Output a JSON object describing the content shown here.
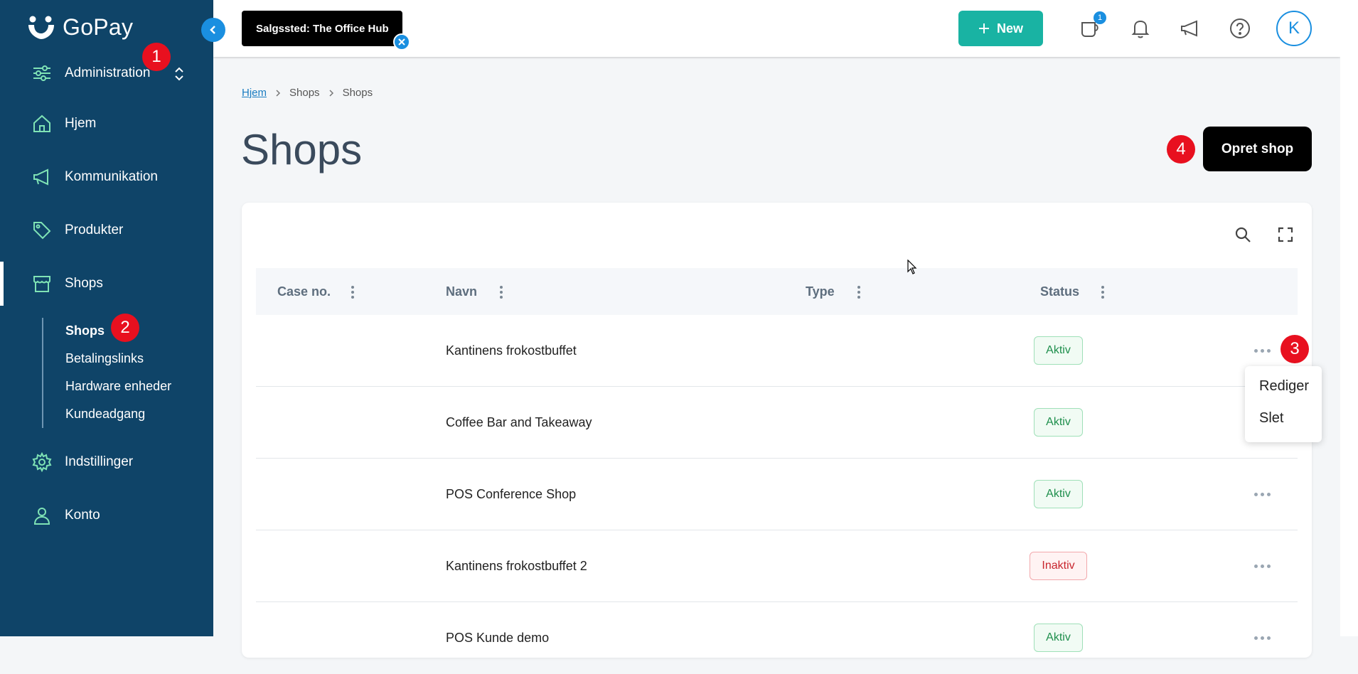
{
  "app": {
    "logo_text": "GoPay"
  },
  "sidebar": {
    "workspace": "Administration",
    "items": [
      {
        "label": "Hjem",
        "icon": "home-icon"
      },
      {
        "label": "Kommunikation",
        "icon": "megaphone-icon"
      },
      {
        "label": "Produkter",
        "icon": "tag-icon"
      },
      {
        "label": "Shops",
        "icon": "store-icon"
      },
      {
        "label": "Indstillinger",
        "icon": "gear-icon"
      },
      {
        "label": "Konto",
        "icon": "user-icon"
      }
    ],
    "sub_items": [
      {
        "label": "Shops"
      },
      {
        "label": "Betalingslinks"
      },
      {
        "label": "Hardware enheder"
      },
      {
        "label": "Kundeadgang"
      }
    ]
  },
  "annotations": [
    "1",
    "2",
    "3",
    "4"
  ],
  "topbar": {
    "sales_point": "Salgssted: The Office Hub",
    "new_label": "New",
    "notification_count": "1",
    "avatar_initial": "K"
  },
  "breadcrumb": [
    "Hjem",
    "Shops",
    "Shops"
  ],
  "page": {
    "title": "Shops",
    "create_button": "Opret shop"
  },
  "table": {
    "columns": [
      "Case no.",
      "Navn",
      "Type",
      "Status"
    ],
    "rows": [
      {
        "case_no": "",
        "name": "Kantinens frokostbuffet",
        "type": "",
        "status": "Aktiv"
      },
      {
        "case_no": "",
        "name": "Coffee Bar and Takeaway",
        "type": "",
        "status": "Aktiv"
      },
      {
        "case_no": "",
        "name": "POS Conference Shop",
        "type": "",
        "status": "Aktiv"
      },
      {
        "case_no": "",
        "name": "Kantinens frokostbuffet 2",
        "type": "",
        "status": "Inaktiv"
      },
      {
        "case_no": "",
        "name": "POS Kunde demo",
        "type": "",
        "status": "Aktiv"
      }
    ]
  },
  "row_menu": {
    "items": [
      "Rediger",
      "Slet"
    ]
  },
  "colors": {
    "sidebar": "#0f4468",
    "accent": "#19b3a3",
    "blue": "#1a8fe0",
    "annotation": "#e8101f"
  }
}
